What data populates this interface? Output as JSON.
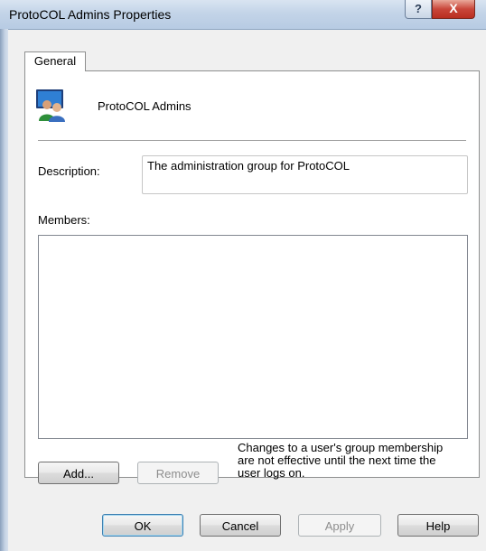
{
  "window": {
    "title": "ProtoCOL Admins Properties"
  },
  "titlebar_buttons": {
    "help": "?",
    "close": "X"
  },
  "tabs": [
    {
      "label": "General"
    }
  ],
  "group": {
    "name": "ProtoCOL Admins",
    "icon": "group-users-icon"
  },
  "description": {
    "label": "Description:",
    "value": "The administration group for ProtoCOL"
  },
  "members": {
    "label": "Members:",
    "items": []
  },
  "member_buttons": {
    "add": "Add...",
    "remove": "Remove"
  },
  "note": {
    "lines": [
      "Changes to a user's group membership",
      "are not effective until the next time the",
      "user logs on."
    ]
  },
  "footer_buttons": {
    "ok": "OK",
    "cancel": "Cancel",
    "apply": "Apply",
    "help": "Help"
  }
}
